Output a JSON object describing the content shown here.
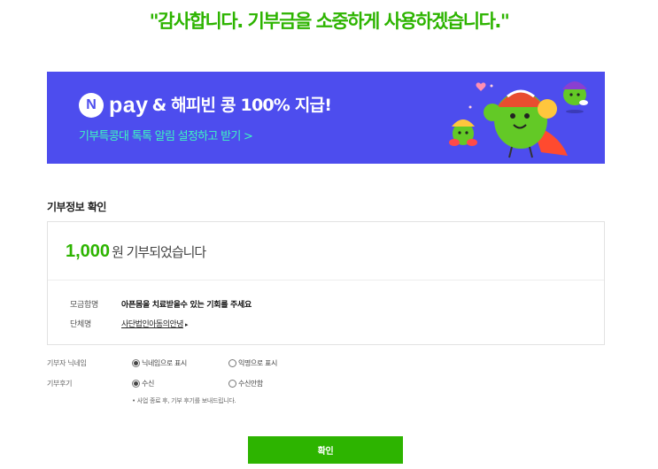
{
  "headline": "\"감사합니다. 기부금을 소중하게 사용하겠습니다.\"",
  "banner": {
    "badge": "N",
    "pay": "pay",
    "title": "& 해피빈 콩 100% 지급!",
    "subtitle": "기부특콩대 톡톡 알림 설정하고 받기 >",
    "background": "#4d4dee",
    "subtitle_color": "#3ff7c0"
  },
  "section_title": "기부정보 확인",
  "donation": {
    "amount": "1,000",
    "amount_text": "원 기부되었습니다",
    "rows": [
      {
        "label": "모금함명",
        "value": "아픈몸을 치료받을수 있는 기회를 주세요"
      },
      {
        "label": "단체명",
        "value": "사단법인아동의안녕",
        "arrow": "▸"
      }
    ]
  },
  "options": {
    "nickname": {
      "label": "기부자 닉네임",
      "choices": [
        "닉네임으로 표시",
        "익명으로 표시"
      ],
      "selected": 0
    },
    "review": {
      "label": "기부후기",
      "choices": [
        "수신",
        "수신안함"
      ],
      "selected": 0
    },
    "note": "• 사업 종료 후, 기부 후기를 보내드립니다."
  },
  "confirm_label": "확인",
  "colors": {
    "accent": "#2db400",
    "border": "#e2e2e2"
  }
}
